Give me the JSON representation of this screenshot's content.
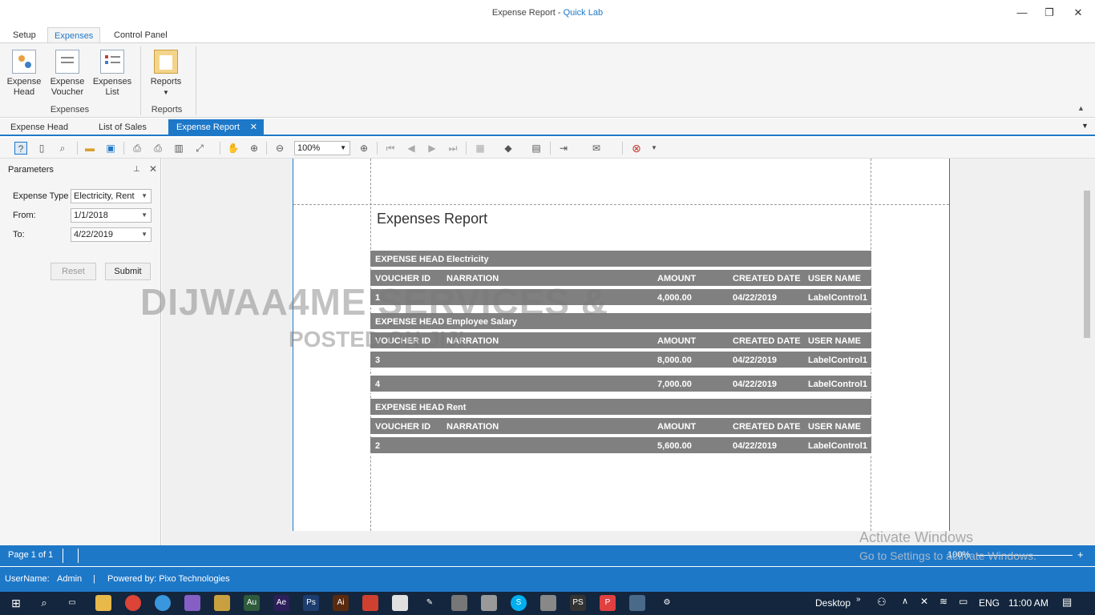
{
  "window": {
    "title_doc": "Expense Report - ",
    "title_app": "Quick Lab",
    "minimize": "—",
    "restore": "❐",
    "close": "✕"
  },
  "ribbon_tabs": [
    "Setup",
    "Expenses",
    "Control Panel"
  ],
  "ribbon": {
    "buttons": [
      {
        "label": "Expense Head",
        "icon": "expense-head-icon"
      },
      {
        "label": "Expense Voucher",
        "icon": "expense-voucher-icon"
      },
      {
        "label": "Expenses List",
        "icon": "expenses-list-icon"
      },
      {
        "label": "Reports",
        "icon": "reports-clipboard-icon"
      }
    ],
    "groups": [
      "Expenses",
      "Reports"
    ]
  },
  "doc_tabs": [
    "Expense Head",
    "List of Sales",
    "Expense Report"
  ],
  "toolbar": {
    "zoom": "100%"
  },
  "params": {
    "title": "Parameters",
    "expense_type_label": "Expense Type",
    "expense_type_value": "Electricity, Rent",
    "from_label": "From:",
    "from_value": "1/1/2018",
    "to_label": "To:",
    "to_value": "4/22/2019",
    "reset": "Reset",
    "submit": "Submit"
  },
  "report": {
    "title": "Expenses Report",
    "head_label": "EXPENSE HEAD",
    "columns": [
      "VOUCHER ID",
      "NARRATION",
      "AMOUNT",
      "CREATED DATE",
      "USER NAME"
    ],
    "groups": [
      {
        "head": "Electricity",
        "rows": [
          {
            "id": "1",
            "narration": "",
            "amount": "4,000.00",
            "date": "04/22/2019",
            "user": "LabelControl1"
          }
        ]
      },
      {
        "head": "Employee Salary",
        "rows": [
          {
            "id": "3",
            "narration": "",
            "amount": "8,000.00",
            "date": "04/22/2019",
            "user": "LabelControl1"
          },
          {
            "id": "4",
            "narration": "",
            "amount": "7,000.00",
            "date": "04/22/2019",
            "user": "LabelControl1"
          }
        ]
      },
      {
        "head": "Rent",
        "rows": [
          {
            "id": "2",
            "narration": "",
            "amount": "5,600.00",
            "date": "04/22/2019",
            "user": "LabelControl1"
          }
        ]
      }
    ]
  },
  "watermark": {
    "line1": "DIJWAA4ME SERVICES &",
    "line2": "POSTED ON JIJI"
  },
  "activate": {
    "line1": "Activate Windows",
    "line2": "Go to Settings to activate Windows."
  },
  "status": {
    "page": "Page 1 of 1",
    "zoom": "100%",
    "username_label": "UserName:",
    "username": "Admin",
    "powered": "Powered by: Pixo Technologies"
  },
  "taskbar": {
    "desktop": "Desktop",
    "lang": "ENG",
    "time": "11:00 AM"
  }
}
